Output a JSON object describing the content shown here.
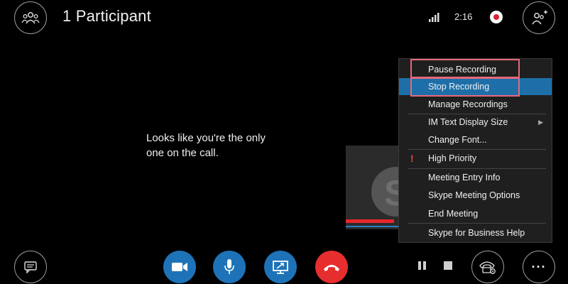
{
  "header": {
    "title": "1 Participant",
    "time": "2:16"
  },
  "call_message": {
    "line1": "Looks like you're the only",
    "line2": "one on the call."
  },
  "menu": {
    "items": [
      {
        "label": "Pause Recording",
        "highlighted": false,
        "outlined": true
      },
      {
        "label": "Stop Recording",
        "highlighted": true,
        "outlined": true
      },
      {
        "label": "Manage Recordings"
      },
      {
        "label": "IM Text Display Size",
        "has_submenu": true
      },
      {
        "label": "Change Font..."
      },
      {
        "label": "High Priority",
        "priority_mark": "!"
      },
      {
        "label": "Meeting Entry Info"
      },
      {
        "label": "Skype Meeting Options"
      },
      {
        "label": "End Meeting"
      },
      {
        "label": "Skype for Business Help"
      }
    ]
  },
  "toolbar": {
    "more_label": "···"
  },
  "colors": {
    "accent_blue": "#1e73b8",
    "hangup_red": "#e62e2e",
    "menu_highlight": "#1e6fa8",
    "outline_pink": "#e8687b",
    "record_red": "#d9232e"
  },
  "icons": {
    "participants": "participants-icon",
    "signal": "signal-strength-icon",
    "add_people": "add-people-icon",
    "chat": "chat-icon",
    "video": "video-camera-icon",
    "mic": "microphone-icon",
    "share": "present-screen-icon",
    "hangup": "hang-up-icon",
    "call_controls": "call-controls-icon",
    "more": "more-options-icon"
  }
}
